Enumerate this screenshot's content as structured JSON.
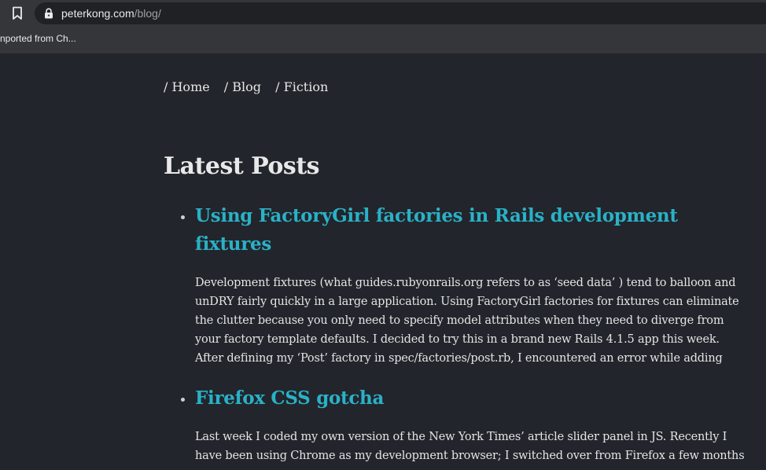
{
  "browser": {
    "url_host": "peterkong.com",
    "url_path": "/blog/",
    "bookmark_label": "nported from Ch..."
  },
  "nav": {
    "items": [
      {
        "label": "/ Home"
      },
      {
        "label": "/ Blog"
      },
      {
        "label": "/ Fiction"
      }
    ]
  },
  "main": {
    "title": "Latest Posts",
    "posts": [
      {
        "title": "Using FactoryGirl factories in Rails development fixtures",
        "excerpt": "Development fixtures (what guides.rubyonrails.org refers to as ‘seed data’ ) tend to balloon and unDRY fairly quickly in a large application. Using FactoryGirl factories for fixtures can eliminate the clutter because you only need to specify model attributes when they need to diverge from your factory template defaults. I decided to try this in a brand new Rails 4.1.5 app this week. After defining my ‘Post’ factory in spec/factories/post.rb, I encountered an error while adding"
      },
      {
        "title": "Firefox CSS gotcha",
        "excerpt": "Last week I coded my own version of the New York Times’ article slider panel in JS. Recently I have been using Chrome as my development browser; I switched over from Firefox a few months"
      }
    ]
  }
}
